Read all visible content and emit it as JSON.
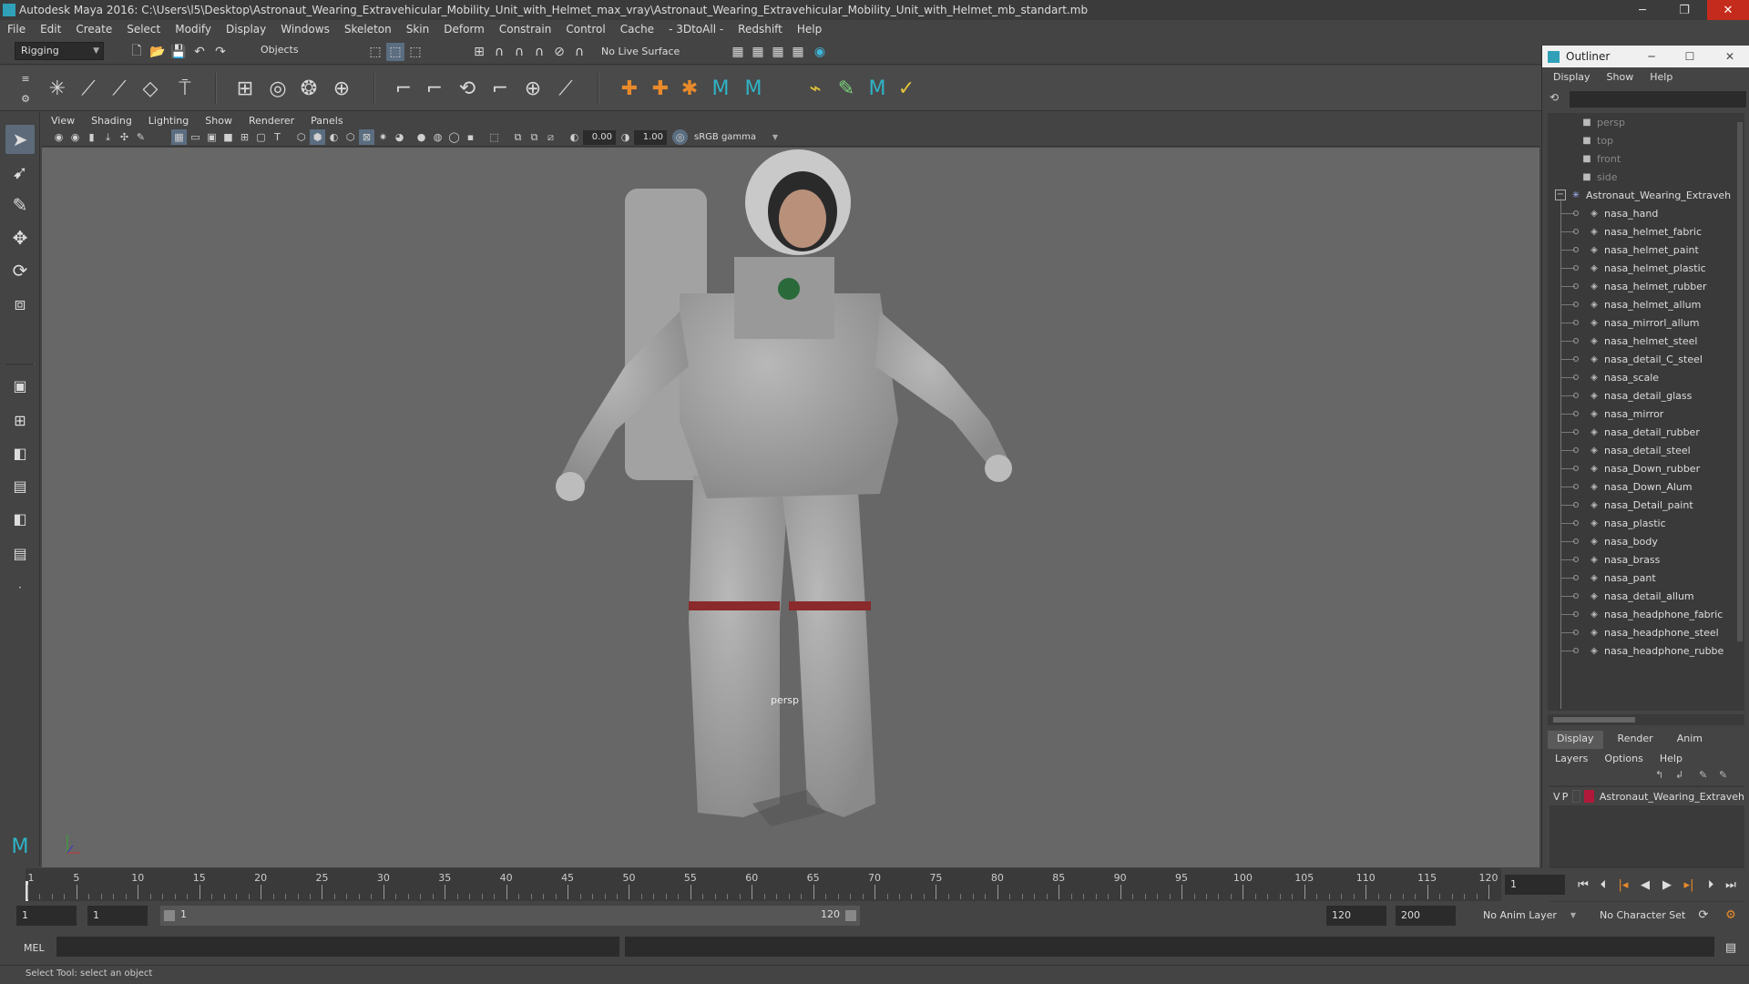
{
  "window": {
    "title": "Autodesk Maya 2016: C:\\Users\\l5\\Desktop\\Astronaut_Wearing_Extravehicular_Mobility_Unit_with_Helmet_max_vray\\Astronaut_Wearing_Extravehicular_Mobility_Unit_with_Helmet_mb_standart.mb",
    "minimize": "─",
    "restore": "❐",
    "close": "✕"
  },
  "menubar": [
    "File",
    "Edit",
    "Create",
    "Select",
    "Modify",
    "Display",
    "Windows",
    "Skeleton",
    "Skin",
    "Deform",
    "Constrain",
    "Control",
    "Cache",
    "- 3DtoAll -",
    "Redshift",
    "Help"
  ],
  "statusline": {
    "mode": "Rigging",
    "selection_mode": "Objects",
    "live_surface": "No Live Surface"
  },
  "viewport": {
    "menu": [
      "View",
      "Shading",
      "Lighting",
      "Show",
      "Renderer",
      "Panels"
    ],
    "exposure": "0.00",
    "gamma": "1.00",
    "color_space": "sRGB gamma",
    "camera_label": "persp"
  },
  "outliner": {
    "title": "Outliner",
    "menu": [
      "Display",
      "Show",
      "Help"
    ],
    "cameras": [
      "persp",
      "top",
      "front",
      "side"
    ],
    "group": "Astronaut_Wearing_Extraveh",
    "children": [
      "nasa_hand",
      "nasa_helmet_fabric",
      "nasa_helmet_paint",
      "nasa_helmet_plastic",
      "nasa_helmet_rubber",
      "nasa_helmet_allum",
      "nasa_mirrorl_allum",
      "nasa_helmet_steel",
      "nasa_detail_C_steel",
      "nasa_scale",
      "nasa_detail_glass",
      "nasa_mirror",
      "nasa_detail_rubber",
      "nasa_detail_steel",
      "nasa_Down_rubber",
      "nasa_Down_Alum",
      "nasa_Detail_paint",
      "nasa_plastic",
      "nasa_body",
      "nasa_brass",
      "nasa_pant",
      "nasa_detail_allum",
      "nasa_headphone_fabric",
      "nasa_headphone_steel",
      "nasa_headphone_rubbe"
    ]
  },
  "layers": {
    "tabs": [
      "Display",
      "Render",
      "Anim"
    ],
    "menu": [
      "Layers",
      "Options",
      "Help"
    ],
    "row": {
      "v": "V",
      "p": "P",
      "name": "Astronaut_Wearing_Extraveh",
      "color": "#b0193a"
    }
  },
  "timeline": {
    "ticks": [
      "1",
      "5",
      "10",
      "15",
      "20",
      "25",
      "30",
      "35",
      "40",
      "45",
      "50",
      "55",
      "60",
      "65",
      "70",
      "75",
      "80",
      "85",
      "90",
      "95",
      "100",
      "105",
      "110",
      "115",
      "120"
    ],
    "current_frame": "1"
  },
  "range": {
    "start": "1",
    "playback_start": "1",
    "range_start_label": "1",
    "range_end_label": "120",
    "playback_end": "120",
    "end": "200",
    "anim_layer": "No Anim Layer",
    "character_set": "No Character Set"
  },
  "cmdline": {
    "label": "MEL"
  },
  "helpline": {
    "text": "Select Tool: select an object"
  },
  "colors": {
    "accent": "#5d6a7a",
    "layer": "#b0193a",
    "viewport_bg": "#676767"
  }
}
